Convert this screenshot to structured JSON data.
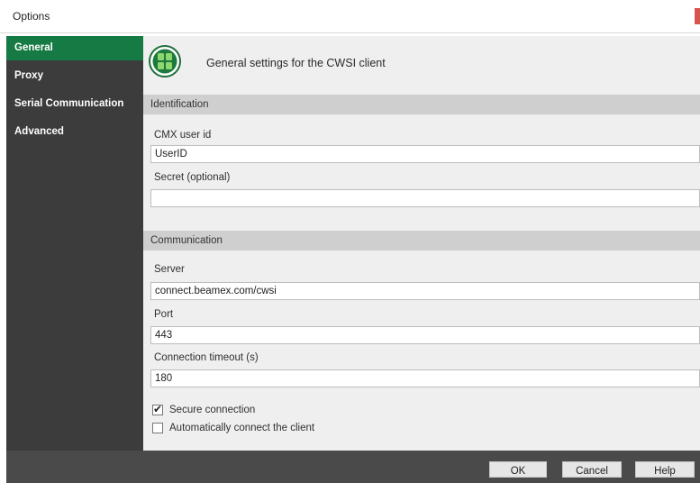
{
  "window": {
    "title": "Options"
  },
  "sidebar": {
    "items": [
      {
        "label": "General",
        "active": true
      },
      {
        "label": "Proxy"
      },
      {
        "label": "Serial Communication"
      },
      {
        "label": "Advanced"
      }
    ]
  },
  "header": {
    "text": "General settings for the CWSI client"
  },
  "identification": {
    "title": "Identification",
    "user_id_label": "CMX user id",
    "user_id_value": "UserID",
    "secret_label": "Secret (optional)",
    "secret_value": ""
  },
  "communication": {
    "title": "Communication",
    "server_label": "Server",
    "server_value": "connect.beamex.com/cwsi",
    "port_label": "Port",
    "port_value": "443",
    "timeout_label": "Connection timeout (s)",
    "timeout_value": "180",
    "secure_label": "Secure connection",
    "secure_checked": true,
    "autoconnect_label": "Automatically connect the client",
    "autoconnect_checked": false
  },
  "footer": {
    "ok": "OK",
    "cancel": "Cancel",
    "help": "Help"
  },
  "colors": {
    "accent": "#167a44",
    "sidebar_bg": "#3c3c3c",
    "close": "#d9534f"
  },
  "icons": {
    "logo": "green-cross-logo-icon",
    "check": "checkmark-icon"
  }
}
